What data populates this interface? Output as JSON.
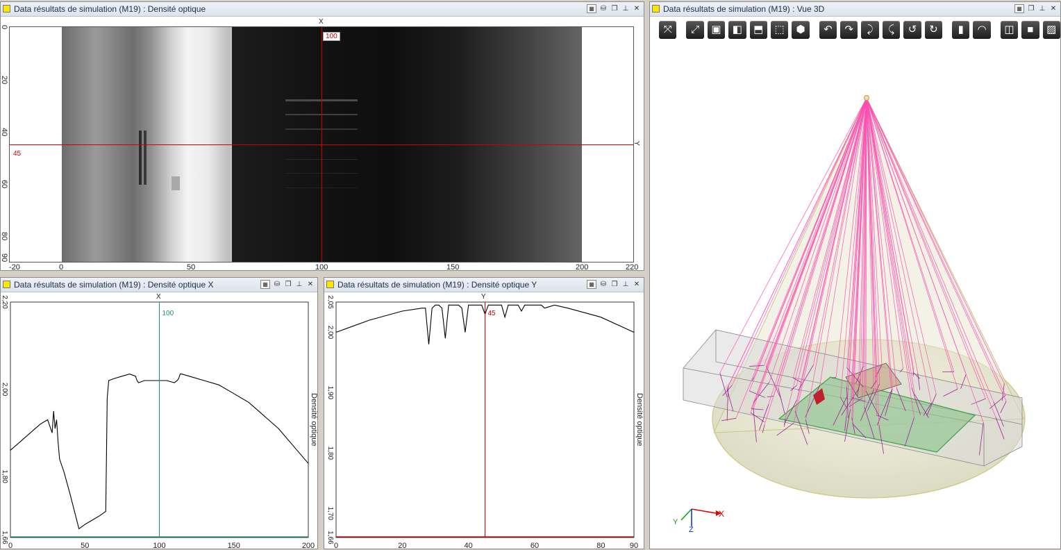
{
  "panels": {
    "image": {
      "title": "Data résultats de simulation (M19) : Densité optique",
      "x_axis_letter": "X",
      "y_axis_letter": "Y",
      "cursor_x": "100",
      "cursor_y": "45",
      "x_ticks": [
        "-20",
        "0",
        "50",
        "100",
        "150",
        "200",
        "220"
      ],
      "y_ticks": [
        "0",
        "20",
        "40",
        "60",
        "80",
        "90"
      ]
    },
    "profile_x": {
      "title": "Data résultats de simulation (M19) : Densité optique X",
      "axis_letter": "X",
      "cursor_value": "100",
      "y_label": "Densité optique",
      "x_ticks": [
        "0",
        "50",
        "100",
        "150",
        "200"
      ],
      "y_ticks": [
        "2,20",
        "2,00",
        "1,80",
        "1,66"
      ]
    },
    "profile_y": {
      "title": "Data résultats de simulation (M19) : Densité optique Y",
      "axis_letter": "Y",
      "cursor_value": "45",
      "y_label": "Densité optique",
      "x_ticks": [
        "0",
        "20",
        "40",
        "60",
        "80",
        "90"
      ],
      "y_ticks": [
        "2,05",
        "2,00",
        "1,90",
        "1,80",
        "1,70",
        "1,66"
      ]
    },
    "view3d": {
      "title": "Data résultats de simulation (M19) : Vue 3D",
      "axis_x": "X",
      "axis_y": "Y",
      "axis_z": "Z"
    }
  },
  "toolbar_3d": [
    {
      "name": "select-tool-icon",
      "glyph": "⤧"
    },
    {
      "name": "fit-view-icon",
      "glyph": "⤢"
    },
    {
      "name": "view-front-icon",
      "glyph": "▣"
    },
    {
      "name": "view-side-icon",
      "glyph": "◧"
    },
    {
      "name": "view-top-icon",
      "glyph": "⬒"
    },
    {
      "name": "view-wire-icon",
      "glyph": "⬚"
    },
    {
      "name": "view-iso-icon",
      "glyph": "⬢"
    },
    {
      "name": "rotate-left-icon",
      "glyph": "↶"
    },
    {
      "name": "rotate-right-icon",
      "glyph": "↷"
    },
    {
      "name": "rotate-down-icon",
      "glyph": "⤸"
    },
    {
      "name": "rotate-up-icon",
      "glyph": "⤹"
    },
    {
      "name": "rotate-ccw-icon",
      "glyph": "↺"
    },
    {
      "name": "rotate-cw-icon",
      "glyph": "↻"
    },
    {
      "name": "ruler-icon",
      "glyph": "▮"
    },
    {
      "name": "protractor-icon",
      "glyph": "◠"
    },
    {
      "name": "box-outline-icon",
      "glyph": "◫"
    },
    {
      "name": "box-solid-icon",
      "glyph": "■"
    },
    {
      "name": "hatch-icon",
      "glyph": "▨"
    }
  ],
  "chart_data": [
    {
      "type": "line",
      "title": "",
      "xlabel": "X",
      "ylabel": "Densité optique",
      "xlim": [
        0,
        200
      ],
      "ylim": [
        1.66,
        2.2
      ],
      "x": [
        0,
        10,
        20,
        25,
        28,
        29,
        30,
        31,
        32,
        33,
        36,
        40,
        46,
        50,
        55,
        60,
        64,
        65,
        66,
        70,
        75,
        80,
        84,
        85,
        86,
        90,
        95,
        100,
        105,
        110,
        112,
        113,
        114,
        115,
        120,
        130,
        140,
        150,
        160,
        170,
        180,
        190,
        200
      ],
      "values": [
        1.86,
        1.89,
        1.92,
        1.93,
        1.9,
        1.95,
        1.91,
        1.93,
        1.88,
        1.84,
        1.81,
        1.76,
        1.68,
        1.69,
        1.7,
        1.71,
        1.72,
        1.98,
        2.02,
        2.025,
        2.03,
        2.035,
        2.03,
        2.02,
        2.015,
        2.02,
        2.02,
        2.02,
        2.02,
        2.015,
        2.02,
        2.025,
        2.035,
        2.035,
        2.03,
        2.02,
        2.01,
        1.99,
        1.97,
        1.94,
        1.91,
        1.87,
        1.83
      ]
    },
    {
      "type": "line",
      "title": "",
      "xlabel": "Y",
      "ylabel": "Densité optique",
      "xlim": [
        0,
        90
      ],
      "ylim": [
        1.66,
        2.05
      ],
      "x": [
        0,
        10,
        20,
        26,
        27,
        28,
        29,
        30,
        31,
        32,
        33,
        34,
        35,
        37,
        38,
        39,
        40,
        44,
        45,
        46,
        48,
        50,
        51,
        52,
        55,
        56,
        57,
        60,
        62,
        63,
        66,
        70,
        80,
        90
      ],
      "values": [
        2.0,
        2.02,
        2.035,
        2.04,
        2.04,
        1.98,
        2.04,
        2.045,
        2.045,
        2.04,
        1.99,
        2.045,
        2.045,
        2.045,
        2.04,
        2.0,
        2.045,
        2.045,
        2.03,
        2.045,
        2.045,
        2.045,
        2.025,
        2.045,
        2.045,
        2.035,
        2.045,
        2.045,
        2.045,
        2.04,
        2.045,
        2.04,
        2.025,
        2.0
      ]
    }
  ]
}
